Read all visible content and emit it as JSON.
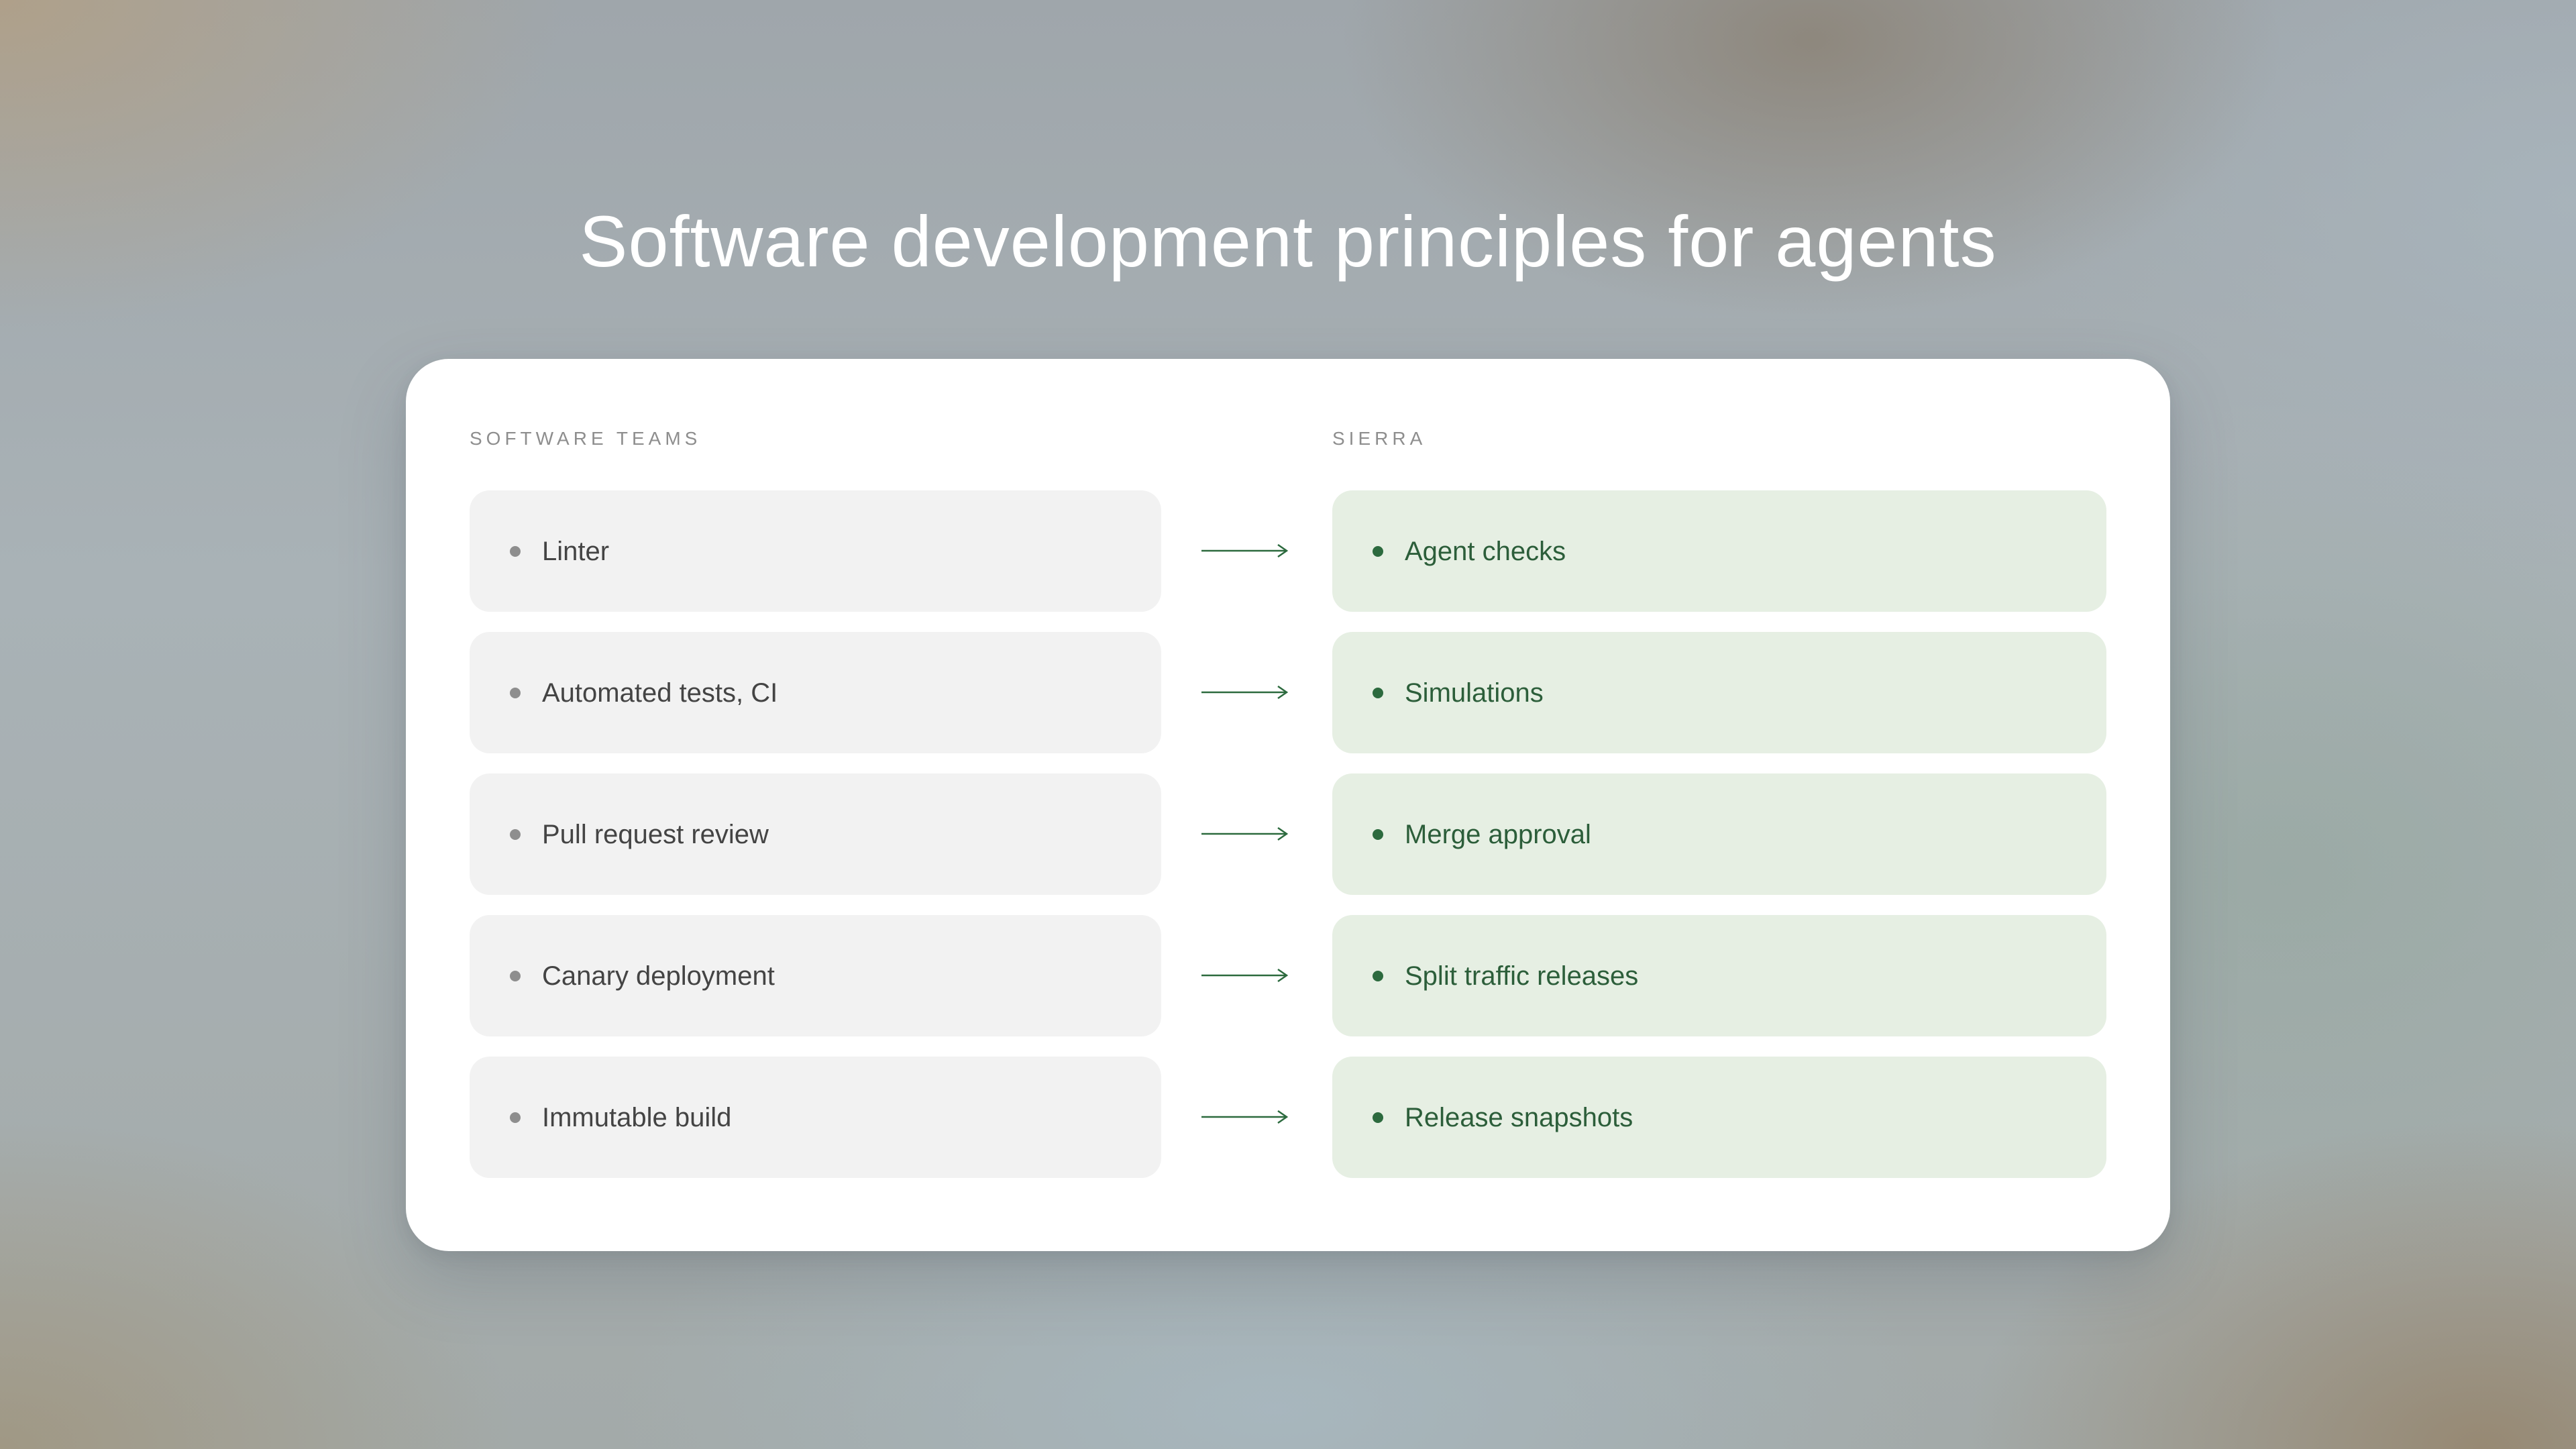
{
  "title": "Software development principles for agents",
  "columns": {
    "left_header": "SOFTWARE TEAMS",
    "right_header": "SIERRA"
  },
  "rows": [
    {
      "left": "Linter",
      "right": "Agent checks"
    },
    {
      "left": "Automated tests, CI",
      "right": "Simulations"
    },
    {
      "left": "Pull request review",
      "right": "Merge approval"
    },
    {
      "left": "Canary deployment",
      "right": "Split traffic releases"
    },
    {
      "left": "Immutable build",
      "right": "Release snapshots"
    }
  ],
  "icons": {
    "bullet": "bullet-dot-icon",
    "connector": "arrow-right-icon"
  },
  "colors": {
    "left_pill": "#f2f2f2",
    "right_pill": "#e6efe3",
    "right_text": "#2c5e3a",
    "arrow": "#2c6a3e"
  }
}
